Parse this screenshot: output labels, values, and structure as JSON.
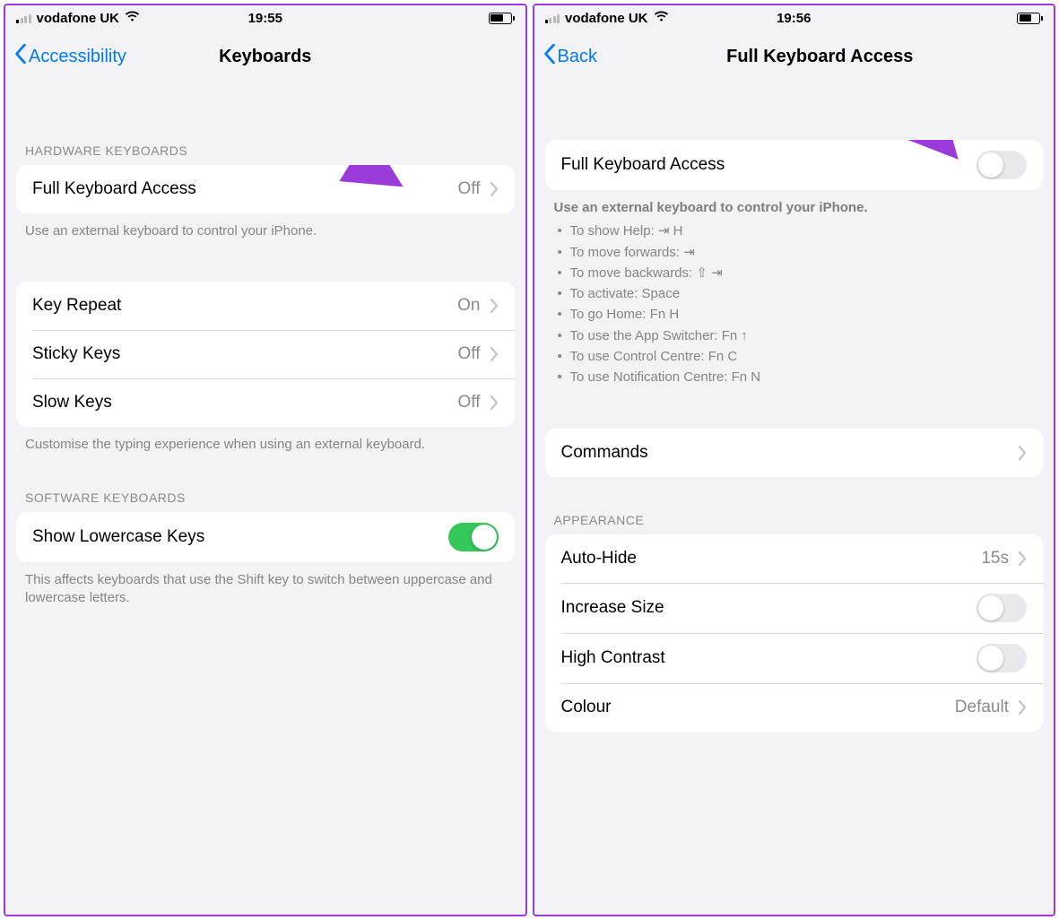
{
  "left": {
    "status": {
      "carrier": "vodafone UK",
      "time": "19:55"
    },
    "nav": {
      "back": "Accessibility",
      "title": "Keyboards"
    },
    "hardware_header": "HARDWARE KEYBOARDS",
    "fka": {
      "label": "Full Keyboard Access",
      "value": "Off"
    },
    "fka_footer": "Use an external keyboard to control your iPhone.",
    "rows": [
      {
        "label": "Key Repeat",
        "value": "On"
      },
      {
        "label": "Sticky Keys",
        "value": "Off"
      },
      {
        "label": "Slow Keys",
        "value": "Off"
      }
    ],
    "rows_footer": "Customise the typing experience when using an external keyboard.",
    "software_header": "SOFTWARE KEYBOARDS",
    "lowercase": {
      "label": "Show Lowercase Keys"
    },
    "lowercase_footer": "This affects keyboards that use the Shift key to switch between uppercase and lowercase letters."
  },
  "right": {
    "status": {
      "carrier": "vodafone UK",
      "time": "19:56"
    },
    "nav": {
      "back": "Back",
      "title": "Full Keyboard Access"
    },
    "fka_toggle": {
      "label": "Full Keyboard Access"
    },
    "help_header": "Use an external keyboard to control your iPhone.",
    "help": [
      "To show Help: ⇥ H",
      "To move forwards: ⇥",
      "To move backwards: ⇧ ⇥",
      "To activate: Space",
      "To go Home: Fn H",
      "To use the App Switcher: Fn ↑",
      "To use Control Centre: Fn C",
      "To use Notification Centre: Fn N"
    ],
    "commands": {
      "label": "Commands"
    },
    "appearance_header": "APPEARANCE",
    "appearance": {
      "autohide": {
        "label": "Auto-Hide",
        "value": "15s"
      },
      "increase": {
        "label": "Increase Size"
      },
      "contrast": {
        "label": "High Contrast"
      },
      "colour": {
        "label": "Colour",
        "value": "Default"
      }
    }
  }
}
